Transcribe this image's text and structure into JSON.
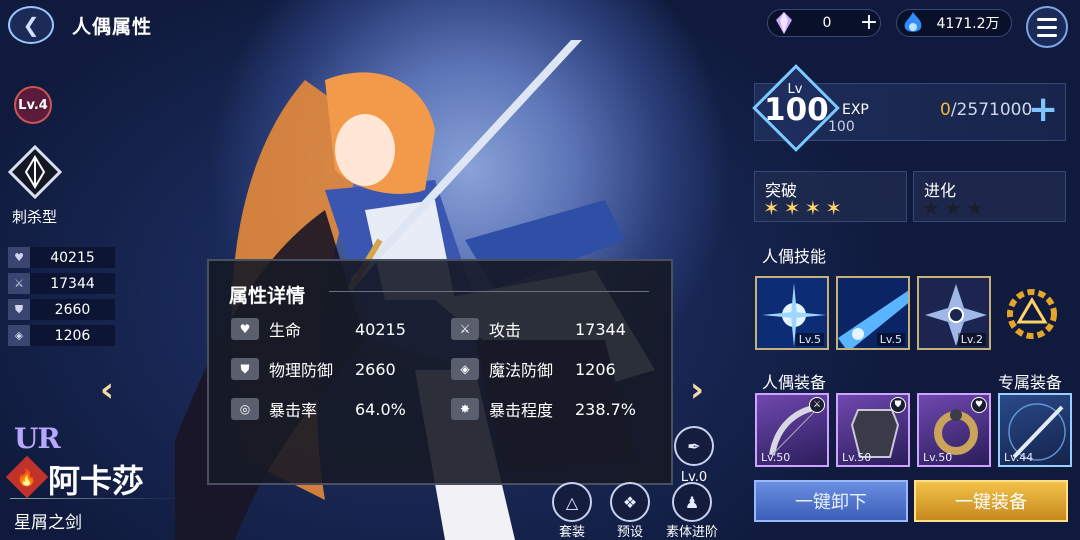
{
  "header": {
    "title": "人偶属性",
    "crystal_count": "0",
    "gold_count": "4171.2万"
  },
  "character": {
    "favor_level": "Lv.4",
    "class_name": "刺杀型",
    "rarity": "UR",
    "name": "阿卡莎",
    "subtitle": "星屑之剑",
    "element_icon": "fire-icon",
    "stats": [
      "40215",
      "17344",
      "2660",
      "1206"
    ]
  },
  "detail_popup": {
    "title": "属性详情",
    "rows": [
      {
        "label": "生命",
        "value": "40215",
        "icon": "heart-icon"
      },
      {
        "label": "攻击",
        "value": "17344",
        "icon": "sword-icon"
      },
      {
        "label": "物理防御",
        "value": "2660",
        "icon": "shield-icon"
      },
      {
        "label": "魔法防御",
        "value": "1206",
        "icon": "magic-shield-icon"
      },
      {
        "label": "暴击率",
        "value": "64.0%",
        "icon": "crit-rate-icon"
      },
      {
        "label": "暴击程度",
        "value": "238.7%",
        "icon": "crit-damage-icon"
      }
    ]
  },
  "bottom_actions": {
    "quill_level": "Lv.0",
    "outfit": "套装",
    "preset": "预设",
    "body_advance": "素体进阶"
  },
  "level_panel": {
    "lv_label": "Lv",
    "level": "100",
    "exp_label": "EXP",
    "max_level": "100",
    "exp_current": "0",
    "exp_total": "/2571000"
  },
  "breakthrough": {
    "label": "突破",
    "stars_filled": 4
  },
  "evolution": {
    "label": "进化",
    "stars": 3,
    "stars_filled": 0
  },
  "skills": {
    "label": "人偶技能",
    "items": [
      {
        "level": "Lv.5",
        "icon": "light-burst-icon"
      },
      {
        "level": "Lv.5",
        "icon": "blue-slash-icon"
      },
      {
        "level": "Lv.2",
        "icon": "eye-star-icon"
      }
    ]
  },
  "equipment": {
    "label": "人偶装备",
    "exclusive_label": "专属装备",
    "items": [
      {
        "level": "Lv.50",
        "icon": "bow-icon",
        "tag": "sword-icon"
      },
      {
        "level": "Lv.50",
        "icon": "armor-icon",
        "tag": "shield-icon"
      },
      {
        "level": "Lv.50",
        "icon": "ring-icon",
        "tag": "heart-icon"
      },
      {
        "level": "Lv.44",
        "icon": "exclusive-sword-icon"
      }
    ]
  },
  "buttons": {
    "unequip_all": "一键卸下",
    "equip_all": "一键装备"
  }
}
